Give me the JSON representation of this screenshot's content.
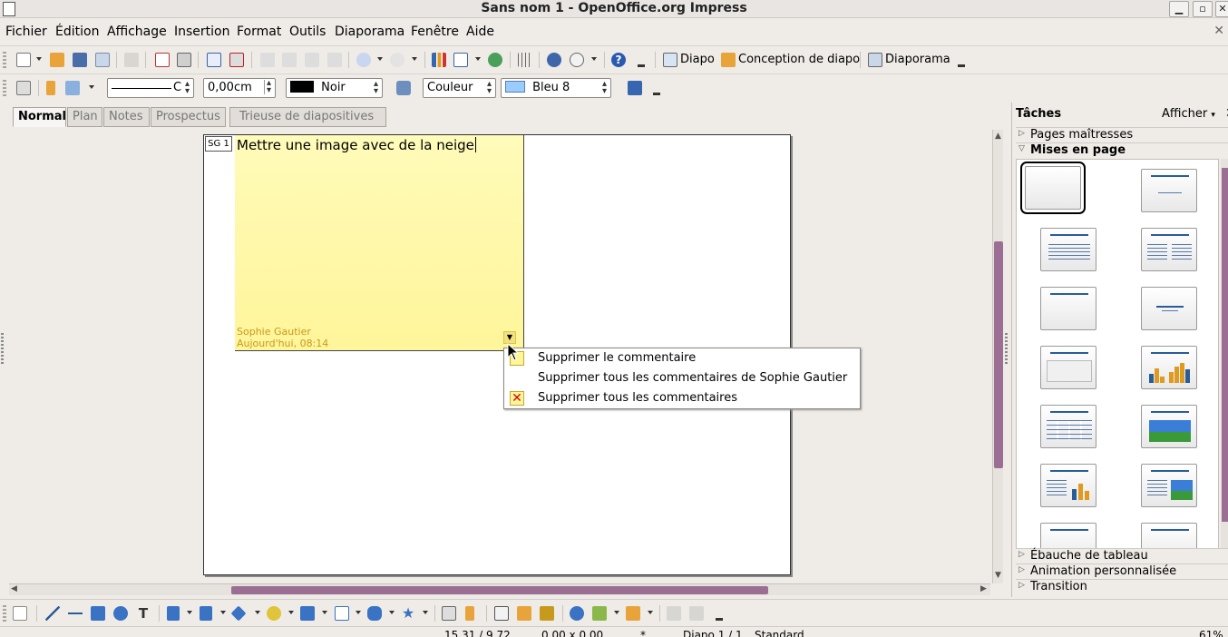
{
  "window": {
    "title": "Sans nom 1 - OpenOffice.org Impress",
    "minimize": "▁",
    "maximize": "▫",
    "close": "✕"
  },
  "menu": [
    "Fichier",
    "Édition",
    "Affichage",
    "Insertion",
    "Format",
    "Outils",
    "Diaporama",
    "Fenêtre",
    "Aide"
  ],
  "toolbar1": {
    "diapo_label": "Diapo",
    "conception_label": "Conception de diapo",
    "diaporama_label": "Diaporama"
  },
  "toolbar2": {
    "line_style_value": "C",
    "line_width_value": "0,00cm",
    "line_color_value": "Noir",
    "area_style_value": "Couleur",
    "area_color_value": "Bleu 8",
    "accent_colors": {
      "noir": "#000000",
      "bleu8": "#99ccff"
    }
  },
  "view_tabs": [
    "Normal",
    "Plan",
    "Notes",
    "Prospectus",
    "Trieuse de diapositives"
  ],
  "active_tab": "Normal",
  "comment": {
    "marker": "SG 1",
    "text": "Mettre une image avec de la neige",
    "author": "Sophie Gautier",
    "timestamp": "Aujourd'hui, 08:14"
  },
  "context_menu": {
    "items": [
      {
        "label": "Supprimer le commentaire",
        "icon": "delete-comment-icon"
      },
      {
        "label": "Supprimer tous les commentaires de Sophie Gautier",
        "icon": ""
      },
      {
        "label": "Supprimer tous les commentaires",
        "icon": "delete-all-comments-icon"
      }
    ]
  },
  "task_pane": {
    "title": "Tâches",
    "view_label": "Afficher",
    "close": "✕",
    "sections": [
      "Pages maîtresses",
      "Mises en page",
      "Ébauche de tableau",
      "Animation personnalisée",
      "Transition"
    ],
    "expanded_section": "Mises en page"
  },
  "statusbar": {
    "position": "15,31 / 9,72",
    "size": "0,00 x 0,00",
    "modified": "*",
    "slide": "Diapo 1 / 1",
    "master": "Standard",
    "zoom": "61%"
  }
}
